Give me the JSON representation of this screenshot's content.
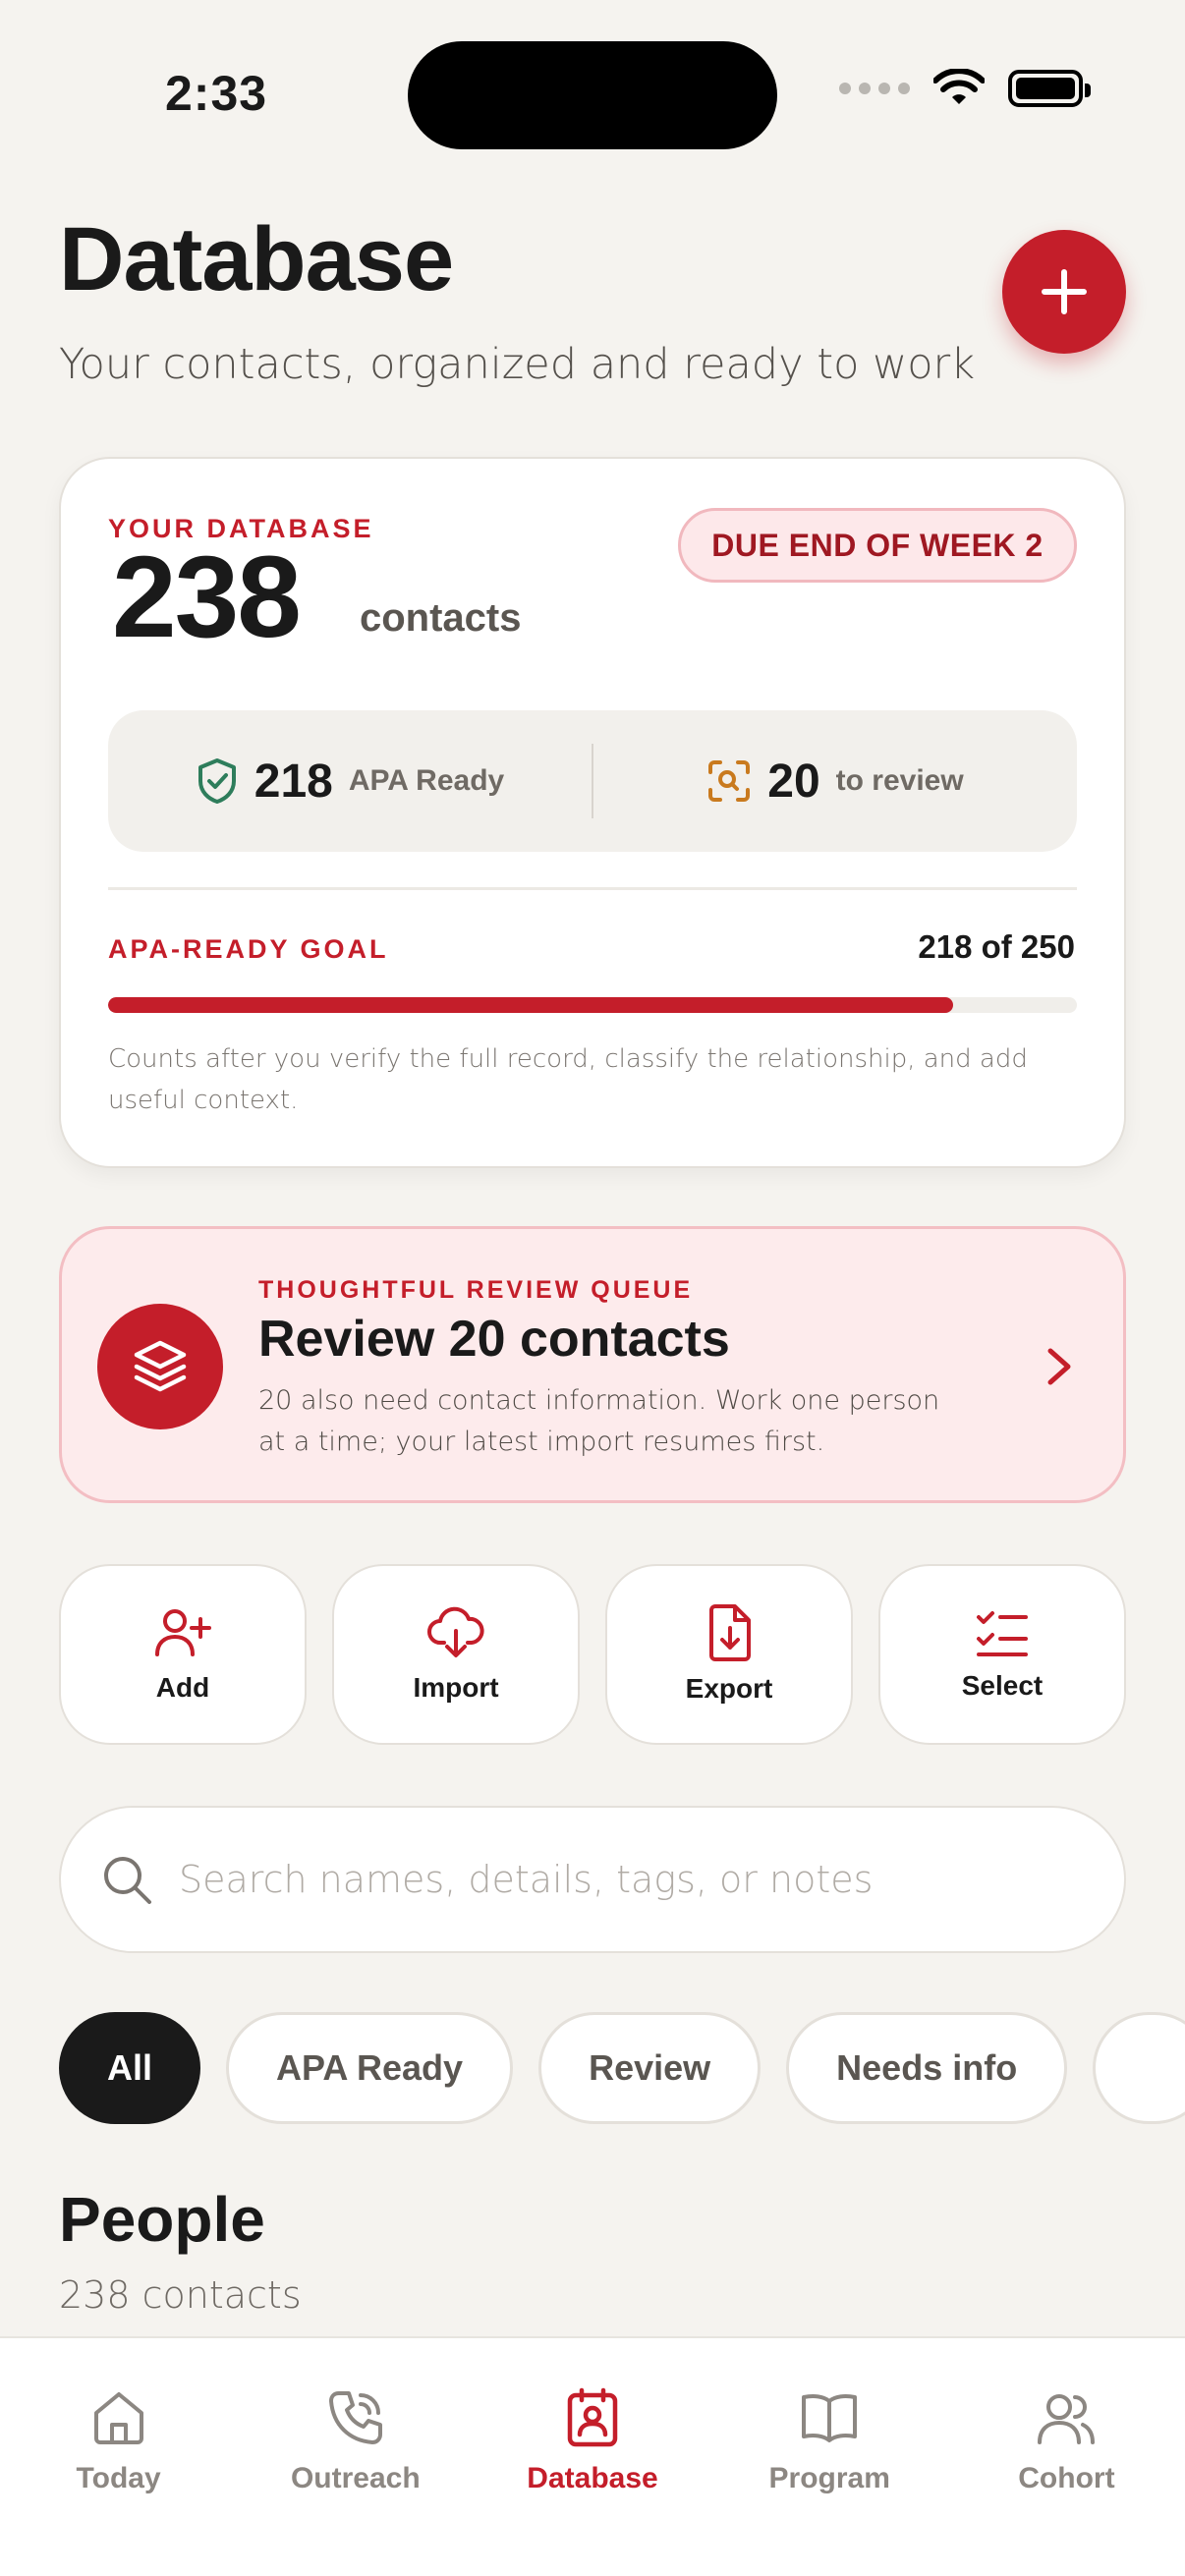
{
  "status_bar": {
    "time": "2:33"
  },
  "header": {
    "title": "Database",
    "subtitle": "Your contacts, organized and ready to work",
    "add_button_icon": "plus-icon"
  },
  "summary": {
    "kicker": "YOUR DATABASE",
    "count": "238",
    "unit": "contacts",
    "due_badge": "DUE END OF WEEK 2",
    "apa_ready": {
      "value": "218",
      "label": "APA Ready",
      "icon": "shield-check-icon"
    },
    "to_review": {
      "value": "20",
      "label": "to review",
      "icon": "scan-search-icon"
    },
    "goal": {
      "label": "APA-READY GOAL",
      "value_text": "218 of 250",
      "progress_fraction": 0.872,
      "note": "Counts after you verify the full record, classify the relationship, and add useful context."
    }
  },
  "review_queue": {
    "kicker": "THOUGHTFUL REVIEW QUEUE",
    "title": "Review 20 contacts",
    "description": "20 also need contact information. Work one person at a time; your latest import resumes first.",
    "icon": "layers-icon"
  },
  "actions": [
    {
      "label": "Add",
      "icon": "user-plus-icon"
    },
    {
      "label": "Import",
      "icon": "cloud-download-icon"
    },
    {
      "label": "Export",
      "icon": "file-download-icon"
    },
    {
      "label": "Select",
      "icon": "list-checks-icon"
    }
  ],
  "search": {
    "placeholder": "Search names, details, tags, or notes",
    "value": ""
  },
  "filters": [
    {
      "label": "All",
      "active": true
    },
    {
      "label": "APA Ready",
      "active": false
    },
    {
      "label": "Review",
      "active": false
    },
    {
      "label": "Needs info",
      "active": false
    }
  ],
  "people": {
    "title": "People",
    "count": "238 contacts"
  },
  "tabs": [
    {
      "label": "Today",
      "icon": "home-icon",
      "active": false
    },
    {
      "label": "Outreach",
      "icon": "phone-icon",
      "active": false
    },
    {
      "label": "Database",
      "icon": "contact-book-icon",
      "active": true
    },
    {
      "label": "Program",
      "icon": "book-icon",
      "active": false
    },
    {
      "label": "Cohort",
      "icon": "users-icon",
      "active": false
    }
  ],
  "colors": {
    "accent": "#C41E2A",
    "background": "#F5F3EF",
    "apa_ready_icon": "#2E7D5B",
    "review_icon": "#C97A1E"
  }
}
